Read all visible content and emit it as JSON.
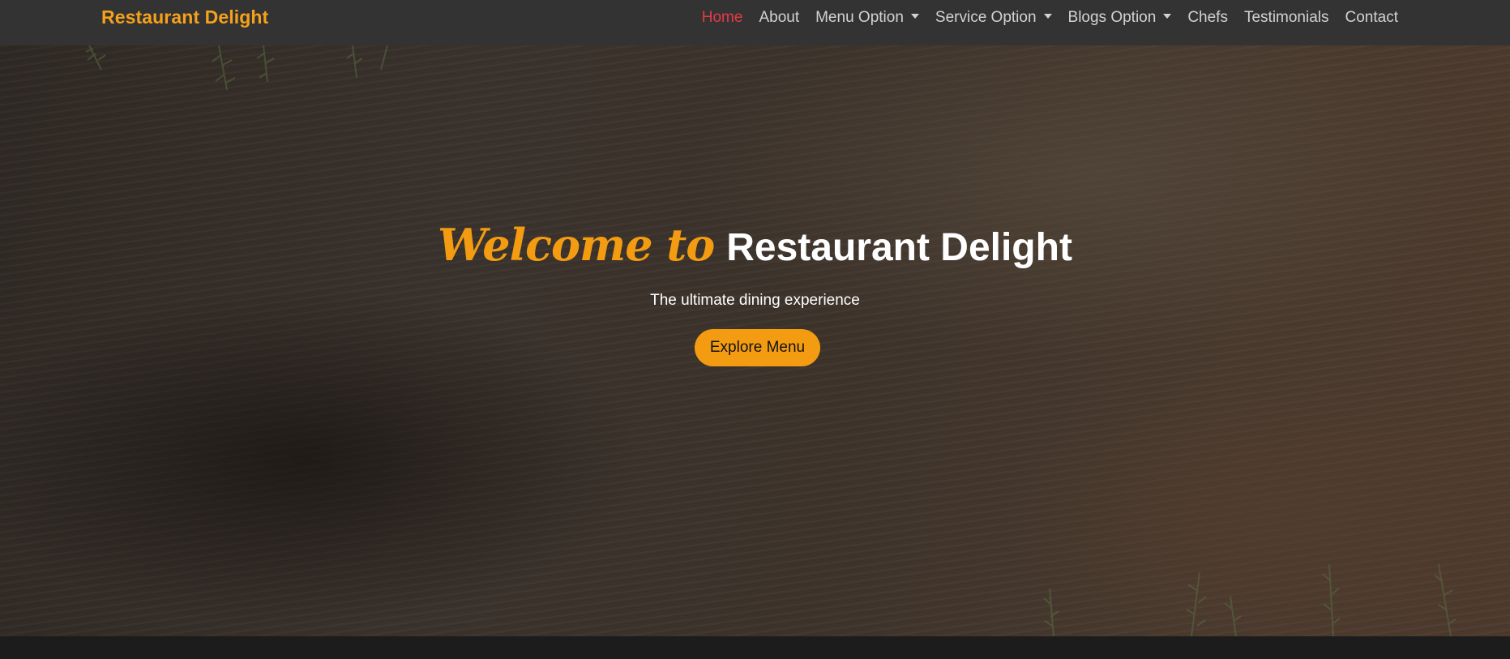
{
  "navbar": {
    "brand": "Restaurant Delight",
    "items": [
      {
        "label": "Home",
        "active": true,
        "dropdown": false
      },
      {
        "label": "About",
        "active": false,
        "dropdown": false
      },
      {
        "label": "Menu Option",
        "active": false,
        "dropdown": true
      },
      {
        "label": "Service Option",
        "active": false,
        "dropdown": true
      },
      {
        "label": "Blogs Option",
        "active": false,
        "dropdown": true
      },
      {
        "label": "Chefs",
        "active": false,
        "dropdown": false
      },
      {
        "label": "Testimonials",
        "active": false,
        "dropdown": false
      },
      {
        "label": "Contact",
        "active": false,
        "dropdown": false
      }
    ]
  },
  "hero": {
    "welcome": "Welcome to",
    "title": "Restaurant Delight",
    "subtitle": "The ultimate dining experience",
    "cta_label": "Explore Menu"
  },
  "colors": {
    "navbar_bg": "#333333",
    "brand": "#f6a11a",
    "active_link": "#e63946",
    "accent": "#f39c12",
    "footer_bg": "#1c1c1c"
  }
}
